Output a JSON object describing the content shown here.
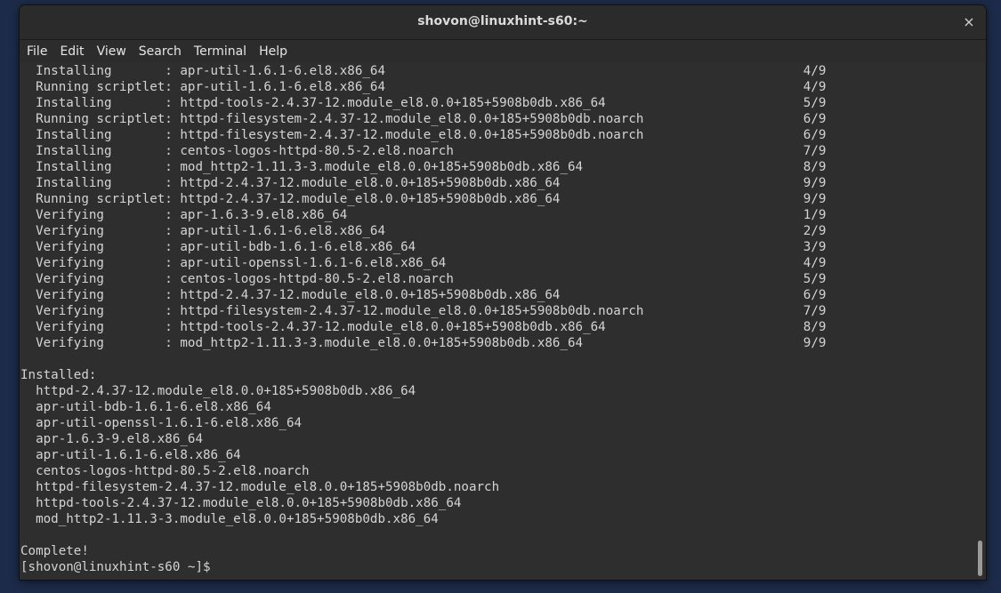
{
  "window": {
    "title": "shovon@linuxhint-s60:~",
    "close_icon": "×"
  },
  "menu": [
    "File",
    "Edit",
    "View",
    "Search",
    "Terminal",
    "Help"
  ],
  "terminal": {
    "lines": [
      "  Installing       : apr-util-1.6.1-6.el8.x86_64                                                       4/9",
      "  Running scriptlet: apr-util-1.6.1-6.el8.x86_64                                                       4/9",
      "  Installing       : httpd-tools-2.4.37-12.module_el8.0.0+185+5908b0db.x86_64                          5/9",
      "  Running scriptlet: httpd-filesystem-2.4.37-12.module_el8.0.0+185+5908b0db.noarch                     6/9",
      "  Installing       : httpd-filesystem-2.4.37-12.module_el8.0.0+185+5908b0db.noarch                     6/9",
      "  Installing       : centos-logos-httpd-80.5-2.el8.noarch                                              7/9",
      "  Installing       : mod_http2-1.11.3-3.module_el8.0.0+185+5908b0db.x86_64                             8/9",
      "  Installing       : httpd-2.4.37-12.module_el8.0.0+185+5908b0db.x86_64                                9/9",
      "  Running scriptlet: httpd-2.4.37-12.module_el8.0.0+185+5908b0db.x86_64                                9/9",
      "  Verifying        : apr-1.6.3-9.el8.x86_64                                                            1/9",
      "  Verifying        : apr-util-1.6.1-6.el8.x86_64                                                       2/9",
      "  Verifying        : apr-util-bdb-1.6.1-6.el8.x86_64                                                   3/9",
      "  Verifying        : apr-util-openssl-1.6.1-6.el8.x86_64                                               4/9",
      "  Verifying        : centos-logos-httpd-80.5-2.el8.noarch                                              5/9",
      "  Verifying        : httpd-2.4.37-12.module_el8.0.0+185+5908b0db.x86_64                                6/9",
      "  Verifying        : httpd-filesystem-2.4.37-12.module_el8.0.0+185+5908b0db.noarch                     7/9",
      "  Verifying        : httpd-tools-2.4.37-12.module_el8.0.0+185+5908b0db.x86_64                          8/9",
      "  Verifying        : mod_http2-1.11.3-3.module_el8.0.0+185+5908b0db.x86_64                             9/9",
      "",
      "Installed:",
      "  httpd-2.4.37-12.module_el8.0.0+185+5908b0db.x86_64",
      "  apr-util-bdb-1.6.1-6.el8.x86_64",
      "  apr-util-openssl-1.6.1-6.el8.x86_64",
      "  apr-1.6.3-9.el8.x86_64",
      "  apr-util-1.6.1-6.el8.x86_64",
      "  centos-logos-httpd-80.5-2.el8.noarch",
      "  httpd-filesystem-2.4.37-12.module_el8.0.0+185+5908b0db.noarch",
      "  httpd-tools-2.4.37-12.module_el8.0.0+185+5908b0db.x86_64",
      "  mod_http2-1.11.3-3.module_el8.0.0+185+5908b0db.x86_64",
      "",
      "Complete!",
      "[shovon@linuxhint-s60 ~]$ "
    ]
  }
}
